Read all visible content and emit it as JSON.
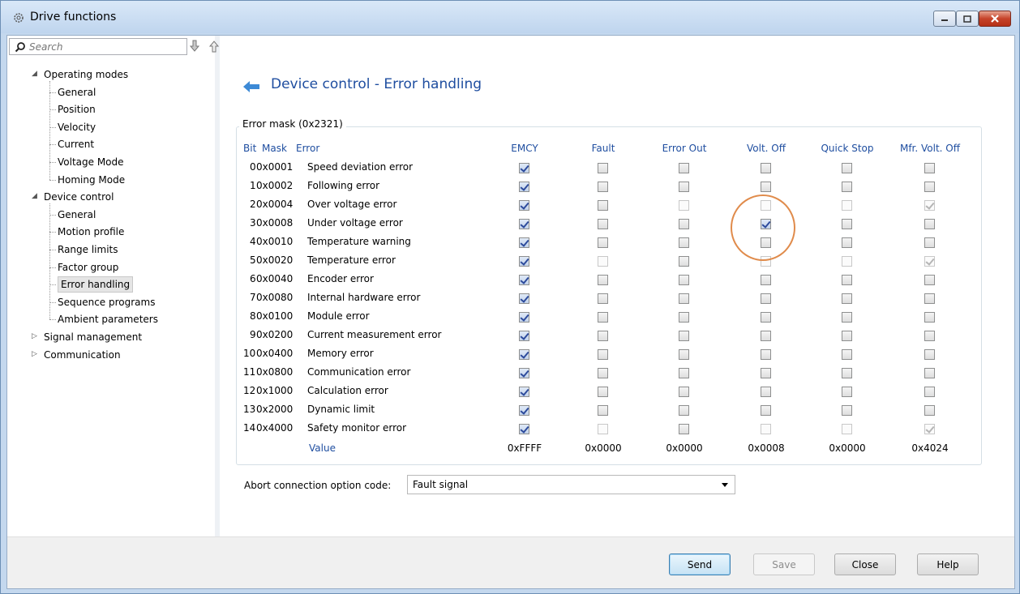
{
  "window": {
    "title": "Drive functions"
  },
  "search": {
    "placeholder": "Search"
  },
  "tree": [
    {
      "label": "Operating modes",
      "level": 0,
      "expanded": true
    },
    {
      "label": "General",
      "level": 1
    },
    {
      "label": "Position",
      "level": 1
    },
    {
      "label": "Velocity",
      "level": 1
    },
    {
      "label": "Current",
      "level": 1
    },
    {
      "label": "Voltage Mode",
      "level": 1
    },
    {
      "label": "Homing Mode",
      "level": 1
    },
    {
      "label": "Device control",
      "level": 0,
      "expanded": true
    },
    {
      "label": "General",
      "level": 1
    },
    {
      "label": "Motion profile",
      "level": 1
    },
    {
      "label": "Range limits",
      "level": 1
    },
    {
      "label": "Factor group",
      "level": 1
    },
    {
      "label": "Error handling",
      "level": 1,
      "selected": true
    },
    {
      "label": "Sequence programs",
      "level": 1
    },
    {
      "label": "Ambient parameters",
      "level": 1
    },
    {
      "label": "Signal management",
      "level": 0,
      "expanded": false
    },
    {
      "label": "Communication",
      "level": 0,
      "expanded": false
    }
  ],
  "page": {
    "title": "Device control - Error handling",
    "group_title": "Error mask (0x2321)"
  },
  "table": {
    "headers": {
      "bit": "Bit",
      "mask": "Mask",
      "error": "Error",
      "columns": [
        "EMCY",
        "Fault",
        "Error Out",
        "Volt. Off",
        "Quick Stop",
        "Mfr. Volt. Off"
      ]
    },
    "rows": [
      {
        "bit": "0",
        "mask": "0x0001",
        "error": "Speed deviation error",
        "checks": [
          1,
          0,
          0,
          0,
          0,
          0
        ],
        "disabled": [
          0,
          0,
          0,
          0,
          0,
          0
        ]
      },
      {
        "bit": "1",
        "mask": "0x0002",
        "error": "Following error",
        "checks": [
          1,
          0,
          0,
          0,
          0,
          0
        ],
        "disabled": [
          0,
          0,
          0,
          0,
          0,
          0
        ]
      },
      {
        "bit": "2",
        "mask": "0x0004",
        "error": "Over voltage error",
        "checks": [
          1,
          0,
          0,
          0,
          0,
          1
        ],
        "disabled": [
          0,
          0,
          1,
          1,
          1,
          1
        ]
      },
      {
        "bit": "3",
        "mask": "0x0008",
        "error": "Under voltage error",
        "checks": [
          1,
          0,
          0,
          1,
          0,
          0
        ],
        "disabled": [
          0,
          0,
          0,
          0,
          0,
          0
        ]
      },
      {
        "bit": "4",
        "mask": "0x0010",
        "error": "Temperature warning",
        "checks": [
          1,
          0,
          0,
          0,
          0,
          0
        ],
        "disabled": [
          0,
          0,
          0,
          0,
          0,
          0
        ]
      },
      {
        "bit": "5",
        "mask": "0x0020",
        "error": "Temperature error",
        "checks": [
          1,
          0,
          0,
          0,
          0,
          1
        ],
        "disabled": [
          0,
          1,
          0,
          1,
          1,
          1
        ]
      },
      {
        "bit": "6",
        "mask": "0x0040",
        "error": "Encoder error",
        "checks": [
          1,
          0,
          0,
          0,
          0,
          0
        ],
        "disabled": [
          0,
          0,
          0,
          0,
          0,
          0
        ]
      },
      {
        "bit": "7",
        "mask": "0x0080",
        "error": "Internal hardware error",
        "checks": [
          1,
          0,
          0,
          0,
          0,
          0
        ],
        "disabled": [
          0,
          0,
          0,
          0,
          0,
          0
        ]
      },
      {
        "bit": "8",
        "mask": "0x0100",
        "error": "Module error",
        "checks": [
          1,
          0,
          0,
          0,
          0,
          0
        ],
        "disabled": [
          0,
          0,
          0,
          0,
          0,
          0
        ]
      },
      {
        "bit": "9",
        "mask": "0x0200",
        "error": "Current measurement error",
        "checks": [
          1,
          0,
          0,
          0,
          0,
          0
        ],
        "disabled": [
          0,
          0,
          0,
          0,
          0,
          0
        ]
      },
      {
        "bit": "10",
        "mask": "0x0400",
        "error": "Memory error",
        "checks": [
          1,
          0,
          0,
          0,
          0,
          0
        ],
        "disabled": [
          0,
          0,
          0,
          0,
          0,
          0
        ]
      },
      {
        "bit": "11",
        "mask": "0x0800",
        "error": "Communication error",
        "checks": [
          1,
          0,
          0,
          0,
          0,
          0
        ],
        "disabled": [
          0,
          0,
          0,
          0,
          0,
          0
        ]
      },
      {
        "bit": "12",
        "mask": "0x1000",
        "error": "Calculation error",
        "checks": [
          1,
          0,
          0,
          0,
          0,
          0
        ],
        "disabled": [
          0,
          0,
          0,
          0,
          0,
          0
        ]
      },
      {
        "bit": "13",
        "mask": "0x2000",
        "error": "Dynamic limit",
        "checks": [
          1,
          0,
          0,
          0,
          0,
          0
        ],
        "disabled": [
          0,
          0,
          0,
          0,
          0,
          0
        ]
      },
      {
        "bit": "14",
        "mask": "0x4000",
        "error": "Safety monitor error",
        "checks": [
          1,
          0,
          0,
          0,
          0,
          1
        ],
        "disabled": [
          0,
          1,
          0,
          1,
          1,
          1
        ]
      }
    ],
    "value_label": "Value",
    "values": [
      "0xFFFF",
      "0x0000",
      "0x0000",
      "0x0008",
      "0x0000",
      "0x4024"
    ]
  },
  "abort": {
    "label": "Abort connection option code:",
    "value": "Fault signal"
  },
  "buttons": {
    "send": "Send",
    "save": "Save",
    "close": "Close",
    "help": "Help"
  },
  "colors": {
    "accent": "#1f4ea0",
    "highlight": "#e08b4b"
  }
}
